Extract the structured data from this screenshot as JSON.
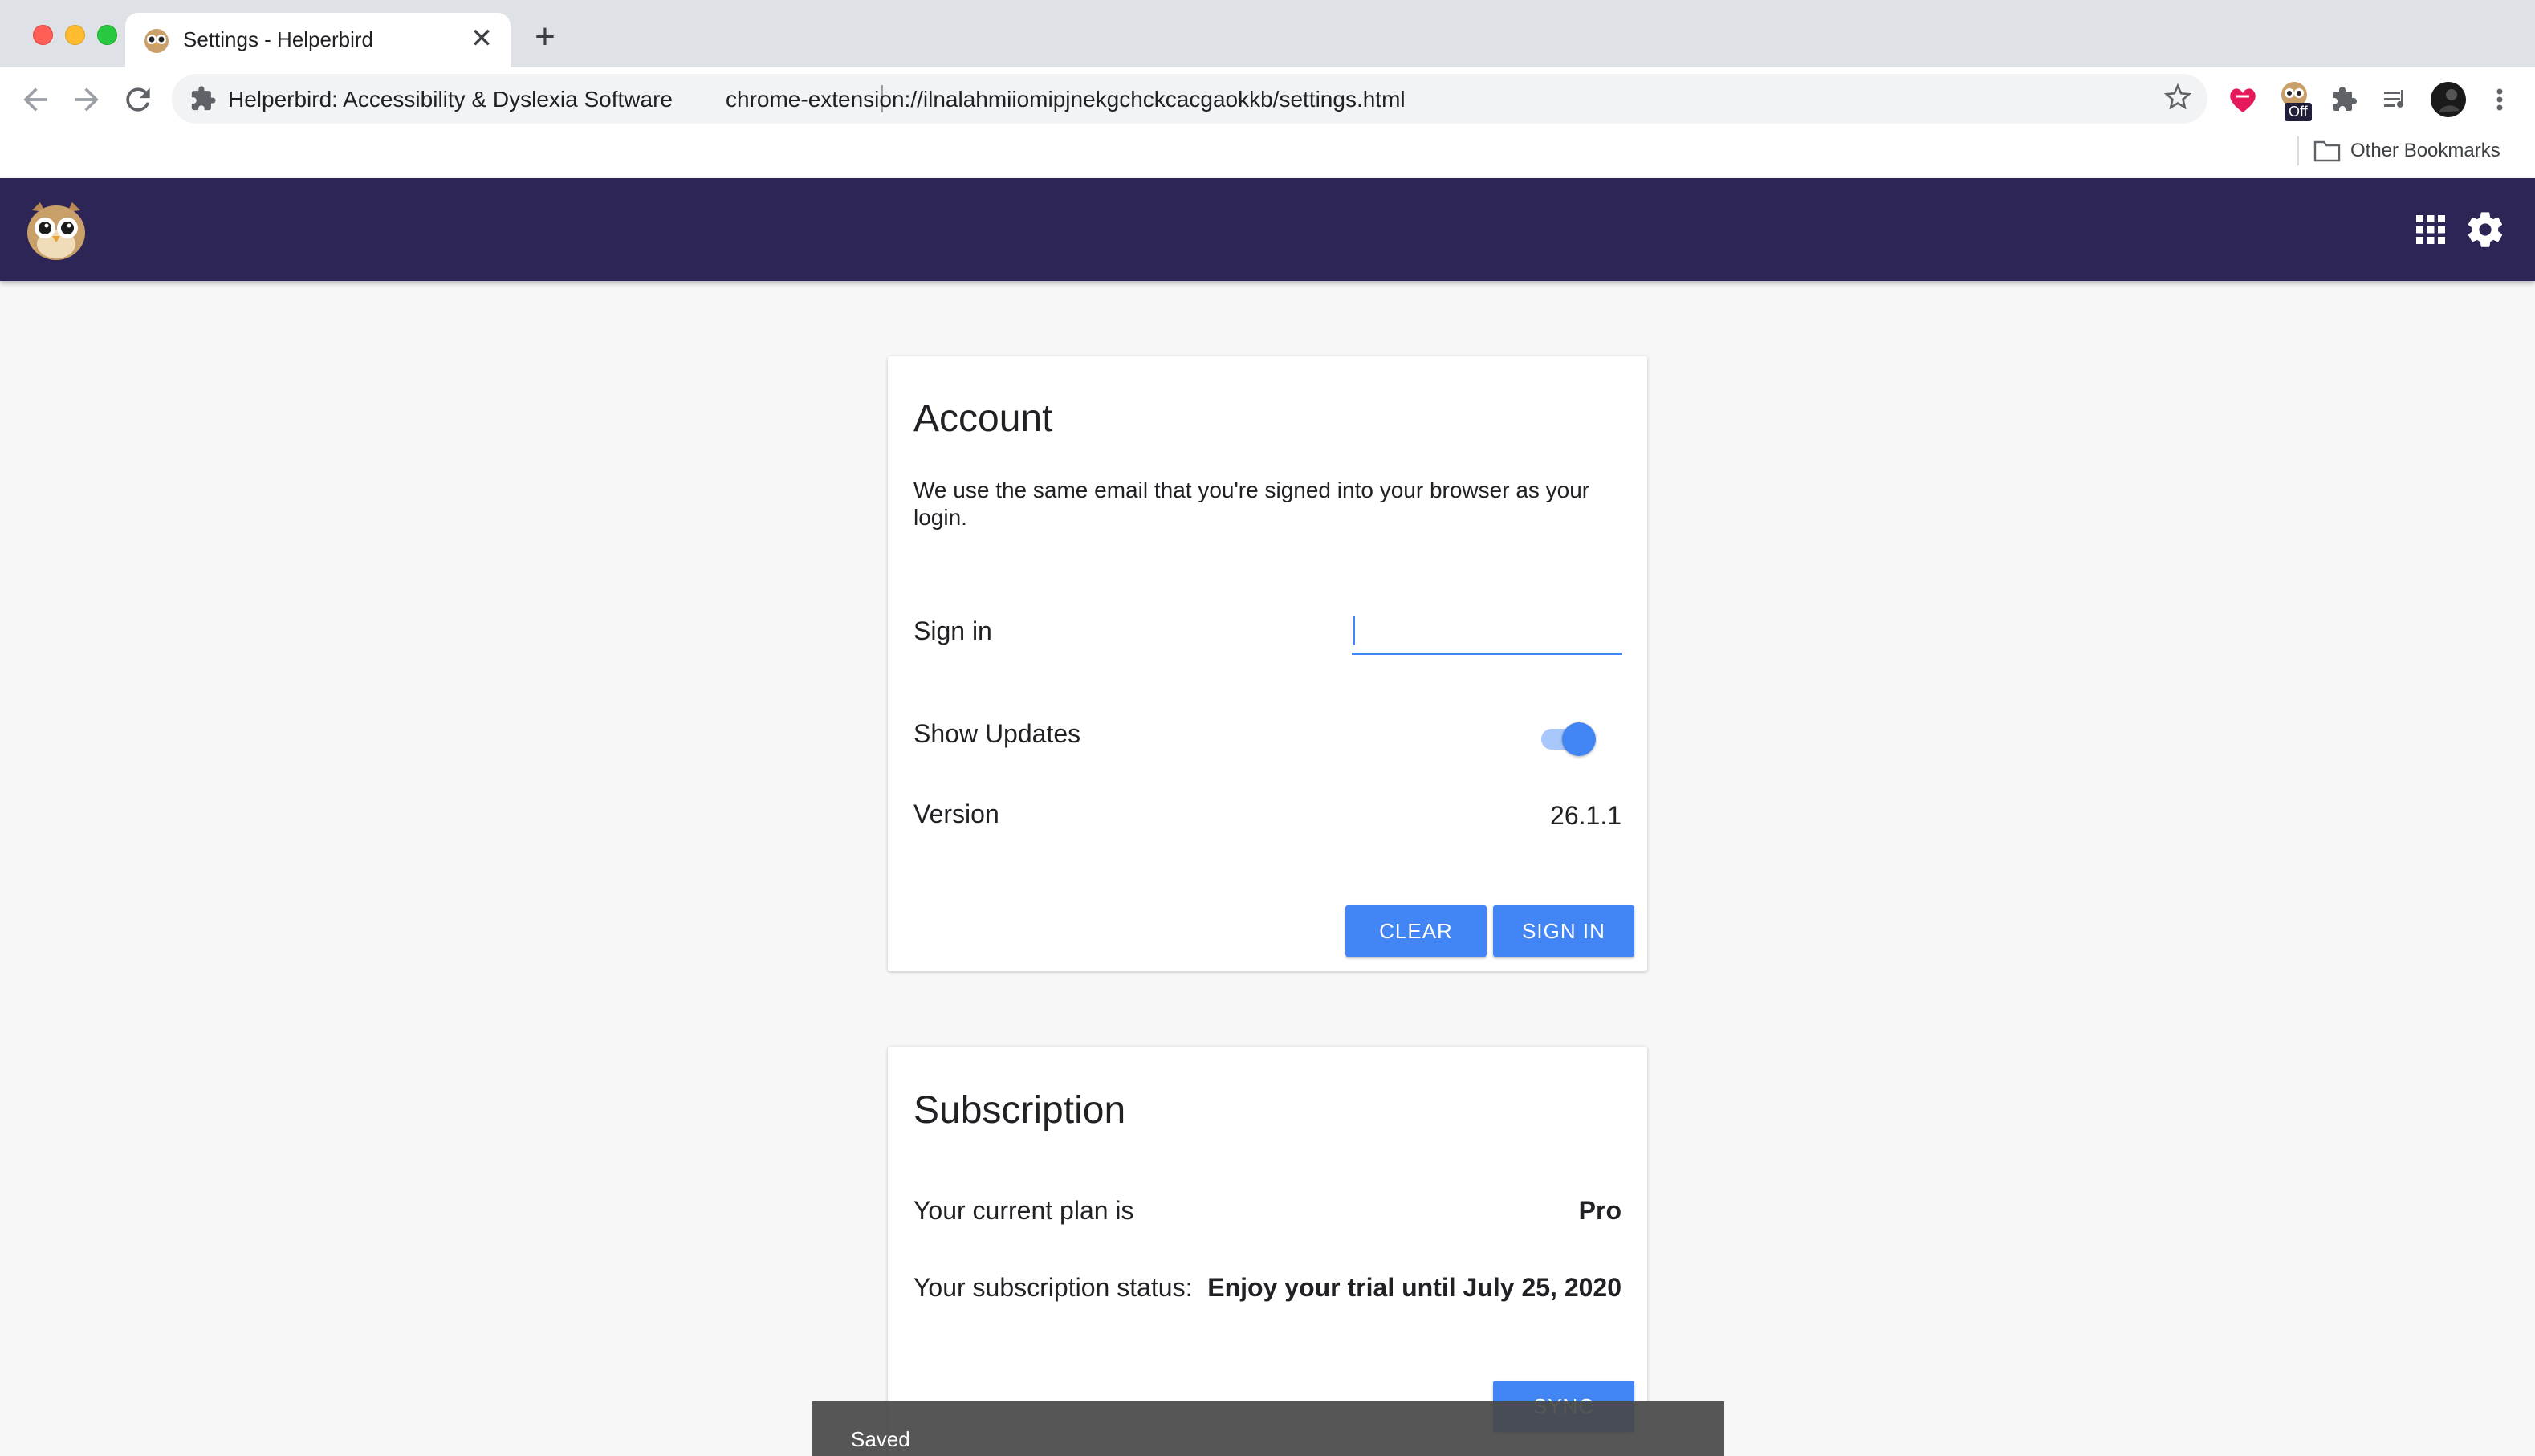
{
  "browser": {
    "tab_title": "Settings - Helperbird",
    "new_tab_symbol": "+",
    "close_symbol": "✕",
    "site_name": "Helperbird: Accessibility & Dyslexia Software",
    "url": "chrome-extension://ilnalahmiiomipjnekgchckcacgaokkb/settings.html",
    "extension_badge": "Off",
    "bookmark_folder": "Other Bookmarks",
    "icons": [
      "back-icon",
      "forward-icon",
      "reload-icon",
      "puzzle-icon",
      "star-icon",
      "heart-extension-icon",
      "helperbird-extension-icon",
      "extensions-icon",
      "media-controls-icon",
      "profile-avatar",
      "menu-icon",
      "folder-icon"
    ]
  },
  "appbar": {
    "background": "#2d2556",
    "icons": [
      "helperbird-owl-logo",
      "apps-grid-icon",
      "settings-gear-icon"
    ]
  },
  "account": {
    "title": "Account",
    "description": "We use the same email that you're signed into your browser as your login.",
    "sign_in_label": "Sign in",
    "sign_in_value": "",
    "show_updates_label": "Show Updates",
    "show_updates_on": true,
    "version_label": "Version",
    "version_value": "26.1.1",
    "clear_button": "CLEAR",
    "sign_in_button": "SIGN IN"
  },
  "subscription": {
    "title": "Subscription",
    "plan_label": "Your current plan is",
    "plan_value": "Pro",
    "status_label": "Your subscription status:",
    "status_value": "Enjoy your trial until July 25, 2020",
    "sync_button": "SYNC"
  },
  "snackbar": {
    "message": "Saved"
  },
  "colors": {
    "accent": "#4285f4",
    "appbar": "#2d2556"
  }
}
